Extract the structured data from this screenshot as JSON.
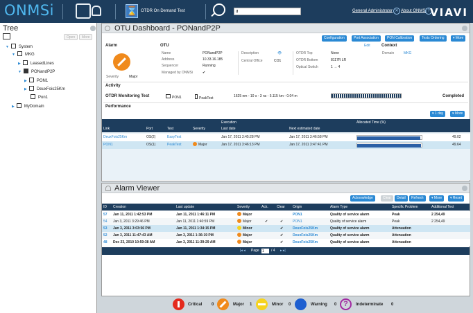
{
  "app": {
    "logo": "ONMSi",
    "brand": "VIAVI"
  },
  "topbar": {
    "otdr_label": "OTDR On Demand Test",
    "search_value": "d",
    "user_link": "General Administrator",
    "about_link": "About ONMSi"
  },
  "tree": {
    "title": "Tree",
    "open": "Open",
    "more": "More",
    "nodes": [
      "System",
      "MKG",
      "LeasedLines",
      "PONandP2P",
      "PON1",
      "DeuxFois25Km",
      "Pon1",
      "MyDomain"
    ]
  },
  "dashboard": {
    "title": "OTU Dashboard - PONandP2P",
    "buttons": [
      "Configuration",
      "Port Association",
      "PON Calibration",
      "Tests Ordering",
      "▾ More"
    ],
    "alarm_label": "Alarm",
    "severity_label": "Severity",
    "severity_value": "Major",
    "otu_label": "OTU",
    "name_label": "Name",
    "name_value": "PONandP2P",
    "address_label": "Address",
    "address_value": "10.33.16.185",
    "sequencer_label": "Sequencer",
    "sequencer_value": "Running",
    "managed_label": "Managed by ONMSi",
    "managed_value": "✔",
    "description_label": "Description",
    "description_value": "👁",
    "central_office_label": "Central Office",
    "central_office_value": "CO1",
    "otdr_top_label": "OTDR Top",
    "otdr_top_value": "None",
    "otdr_bottom_label": "OTDR Bottom",
    "otdr_bottom_value": "8117R LR",
    "optical_switch_label": "Optical Switch",
    "optical_switch_value": "1 → 4",
    "edit": "Edit",
    "context_label": "Context",
    "domain_label": "Domain",
    "domain_value": "MKG",
    "activity_label": "Activity",
    "otdr_test_label": "OTDR Monitoring Test",
    "activity_port": "PON1",
    "activity_test": "PeakTest",
    "activity_details": "1625 nm - 10 s - 3 ns - 5.115 km - 0.04 m",
    "activity_status": "Completed",
    "activity_progress": 1.0,
    "performance_label": "Performance",
    "perf_buttons": [
      "▾ 1 day",
      "▾ More"
    ]
  },
  "performance": {
    "execution_header": "Execution",
    "allocated_header": "Allocated Time (%)",
    "columns": [
      "Link",
      "Port",
      "Test",
      "Severity",
      "Last date",
      "Next estimated date"
    ],
    "rows": [
      {
        "link": "DeuxFois25Km",
        "port": "OS(2)",
        "test": "EasyTest",
        "severity": "",
        "last": "Jan 17, 2011 3:45:28 PM",
        "next": "Jan 17, 2011 3:46:58 PM",
        "alloc": 49.02,
        "alloc_text": "49.02"
      },
      {
        "link": "PON1",
        "port": "OS(1)",
        "test": "PeakTest",
        "severity": "Major",
        "last": "Jan 17, 2011 3:46:13 PM",
        "next": "Jan 17, 2011 3:47:41 PM",
        "alloc": 49.64,
        "alloc_text": "49.64"
      }
    ]
  },
  "alarm_viewer": {
    "title": "Alarm Viewer",
    "buttons": [
      "Acknowledge",
      "Clear",
      "Detail",
      "Refresh",
      "▾ More",
      "▾ Reset"
    ],
    "columns": [
      "ID",
      "Creation",
      "Last update",
      "Severity",
      "Ack.",
      "Clear",
      "Origin",
      "Alarm Type",
      "Specific Problem",
      "Additional Text"
    ],
    "rows": [
      {
        "id": "57",
        "creation": "Jan 11, 2011 1:42:53 PM",
        "update": "Jan 11, 2011 1:46:11 PM",
        "severity": "Major",
        "ack": "",
        "clear": "",
        "origin": "PON1",
        "type": "Quality of service alarm",
        "problem": "Peak",
        "text": "2 254,49",
        "bold": true
      },
      {
        "id": "54",
        "creation": "Jan 3, 2011 3:29:46 PM",
        "update": "Jan 11, 2011 1:40:59 PM",
        "severity": "Major",
        "ack": "✔",
        "clear": "✔",
        "origin": "PON1",
        "type": "Quality of service alarm",
        "problem": "Peak",
        "text": "2 254,49",
        "bold": false
      },
      {
        "id": "53",
        "creation": "Jan 3, 2011 3:03:56 PM",
        "update": "Jan 11, 2011 1:34:15 PM",
        "severity": "Minor",
        "ack": "",
        "clear": "✔",
        "origin": "DeuxFois25Km",
        "type": "Quality of service alarm",
        "problem": "Attenuation",
        "text": "",
        "bold": true
      },
      {
        "id": "52",
        "creation": "Jan 3, 2011 11:47:43 AM",
        "update": "Jan 3, 2011 1:36:19 PM",
        "severity": "Major",
        "ack": "",
        "clear": "✔",
        "origin": "DeuxFois25Km",
        "type": "Quality of service alarm",
        "problem": "Attenuation",
        "text": "",
        "bold": true
      },
      {
        "id": "48",
        "creation": "Dec 23, 2010 10:59:38 AM",
        "update": "Jan 3, 2011 11:39:29 AM",
        "severity": "Major",
        "ack": "",
        "clear": "✔",
        "origin": "DeuxFois25Km",
        "type": "Quality of service alarm",
        "problem": "Attenuation",
        "text": "",
        "bold": true
      }
    ],
    "pager_label": "Page",
    "pager_value": "1",
    "pager_total": "/ 4"
  },
  "legend": [
    {
      "label": "Critical",
      "count": "0",
      "color": "#e42a1d"
    },
    {
      "label": "Major",
      "count": "1",
      "color": "#f08a1c"
    },
    {
      "label": "Minor",
      "count": "0",
      "color": "#f6d31e"
    },
    {
      "label": "Warning",
      "count": "0",
      "color": "#1e5fd0"
    },
    {
      "label": "Indeterminate",
      "count": "0",
      "color": "#a22ca3"
    }
  ],
  "colors": {
    "header": "#1d3d5d",
    "accent": "#2a89d4",
    "major": "#f08a1c",
    "minor": "#f6d31e",
    "row_highlight": "#cfe6f3"
  }
}
